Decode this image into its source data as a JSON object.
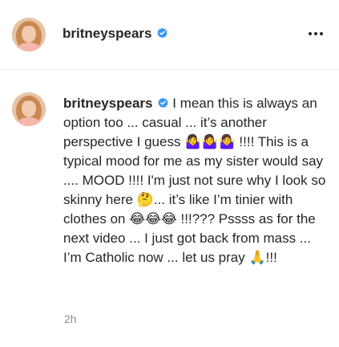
{
  "post_header": {
    "username": "britneyspears",
    "avatar_icon": "profile-avatar",
    "verified_icon": "verified-badge-icon",
    "more_icon": "more-options-icon",
    "verified_color": "#3897f0"
  },
  "caption": {
    "username": "britneyspears",
    "text": " I mean this is always an option too ... casual ... it’s another perspective I guess 🤷‍♀️🤷‍♀️🤷‍♀️ !!!! This is a typical mood for me as my sister would say .... MOOD !!!! I'm just not sure why I look so skinny here 🤔... it’s like I’m tinier with clothes on 😂😂😂 !!!??? Pssss as for the next video ... I just got back from mass ... I’m Catholic now ... let us pray 🙏!!!",
    "timestamp": "2h"
  }
}
